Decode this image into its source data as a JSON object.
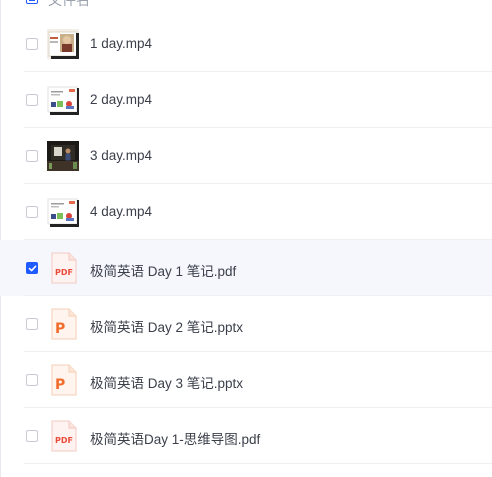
{
  "header": {
    "column_label": "文件名",
    "sort_glyph": "▾"
  },
  "colors": {
    "accent": "#1f5bff",
    "pdf": "#e84c3d",
    "pptx": "#f26b2b"
  },
  "files": [
    {
      "name": "1 day.mp4",
      "type": "video",
      "selected": false,
      "thumb_icon": "portrait-video-thumbnail"
    },
    {
      "name": "2 day.mp4",
      "type": "video",
      "selected": false,
      "thumb_icon": "slide-video-thumbnail"
    },
    {
      "name": "3 day.mp4",
      "type": "video",
      "selected": false,
      "thumb_icon": "classroom-video-thumbnail"
    },
    {
      "name": "4 day.mp4",
      "type": "video",
      "selected": false,
      "thumb_icon": "slide-video-thumbnail"
    },
    {
      "name": "极简英语 Day 1 笔记.pdf",
      "type": "pdf",
      "selected": true,
      "icon": "pdf-file-icon",
      "icon_label": "PDF"
    },
    {
      "name": "极简英语 Day 2 笔记.pptx",
      "type": "pptx",
      "selected": false,
      "icon": "pptx-file-icon",
      "icon_label": "P"
    },
    {
      "name": "极简英语 Day 3 笔记.pptx",
      "type": "pptx",
      "selected": false,
      "icon": "pptx-file-icon",
      "icon_label": "P"
    },
    {
      "name": "极简英语Day 1-思维导图.pdf",
      "type": "pdf",
      "selected": false,
      "icon": "pdf-file-icon",
      "icon_label": "PDF"
    }
  ]
}
